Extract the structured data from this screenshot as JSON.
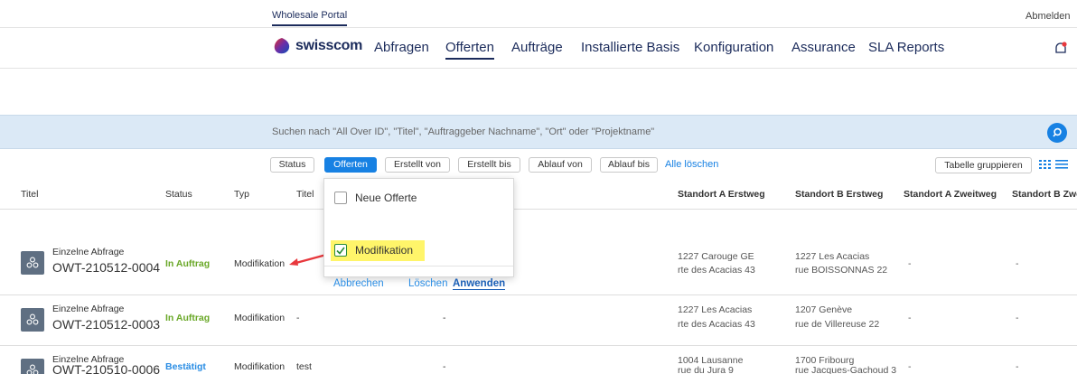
{
  "topbar": {
    "portal_tab": "Wholesale Portal",
    "logout": "Abmelden"
  },
  "nav": {
    "logo_text": "swisscom",
    "items": [
      "Abfragen",
      "Offerten",
      "Aufträge",
      "Installierte Basis",
      "Konfiguration",
      "Assurance",
      "SLA Reports"
    ],
    "active": "Offerten"
  },
  "search": {
    "placeholder": "Suchen nach \"All Over ID\", \"Titel\", \"Auftraggeber Nachname\", \"Ort\" oder \"Projektname\""
  },
  "filters": {
    "chips": [
      "Status",
      "Offerten",
      "Erstellt von",
      "Erstellt bis",
      "Ablauf von",
      "Ablauf bis"
    ],
    "active": "Offerten",
    "clear_all": "Alle löschen",
    "group_table": "Tabelle gruppieren"
  },
  "table": {
    "columns": [
      "Titel",
      "Status",
      "Typ",
      "Titel",
      "Standort A Erstweg",
      "Standort B Erstweg",
      "Standort A Zweitweg",
      "Standort B Zweit"
    ],
    "rows": [
      {
        "kind": "Einzelne Abfrage",
        "id": "OWT-210512-0004",
        "status": "In Auftrag",
        "typ": "Modifikation",
        "titel": "",
        "mid": "",
        "a1": "1227 Carouge GE",
        "a2": "rte des Acacias 43",
        "b1": "1227 Les Acacias",
        "b2": "rue BOISSONNAS 22",
        "az": "-",
        "bz": "-"
      },
      {
        "kind": "Einzelne Abfrage",
        "id": "OWT-210512-0003",
        "status": "In Auftrag",
        "typ": "Modifikation",
        "titel": "-",
        "mid": "-",
        "a1": "1227 Les Acacias",
        "a2": "rte des Acacias 43",
        "b1": "1207 Genève",
        "b2": "rue de Villereuse 22",
        "az": "-",
        "bz": "-"
      },
      {
        "kind": "Einzelne Abfrage",
        "id": "OWT-210510-0006",
        "status": "Bestätigt",
        "typ": "Modifikation",
        "titel": "test",
        "mid": "-",
        "a1": "1004 Lausanne",
        "a2": "rue du Jura 9",
        "b1": "1700 Fribourg",
        "b2": "rue Jacques-Gachoud 3",
        "az": "-",
        "bz": "-"
      }
    ]
  },
  "dropdown": {
    "options": [
      {
        "label": "Neue Offerte",
        "checked": false
      },
      {
        "label": "Modifikation",
        "checked": true
      }
    ],
    "cancel": "Abbrechen",
    "delete": "Löschen",
    "apply": "Anwenden"
  },
  "colors": {
    "brand": "#1b2b5b",
    "accent": "#1781e3",
    "search_band": "#dbe9f6",
    "status_green": "#6aa828",
    "status_blue": "#2a8de4",
    "highlight": "#fff56a",
    "arrow": "#e8383d"
  }
}
